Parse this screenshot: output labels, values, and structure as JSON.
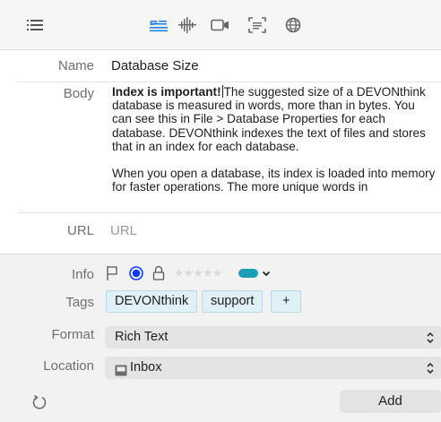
{
  "toolbar": {
    "icons": [
      "list-icon",
      "text-format-icon",
      "waveform-icon",
      "video-icon",
      "scan-icon",
      "globe-icon"
    ]
  },
  "fields": {
    "name_label": "Name",
    "name_value": "Database Size",
    "body_label": "Body",
    "body_bold": "Index is important!",
    "body_p1_rest": "The suggested size of a DEVONthink database is measured in words, more than in bytes. You can see this in File > Database Properties for each database. DEVONthink indexes the text of files and stores that in an index for each database.",
    "body_p2": "When you open a database, its index is loaded into memory for faster operations. The more unique words in",
    "url_label": "URL",
    "url_placeholder": "URL"
  },
  "info": {
    "label": "Info",
    "tags_label": "Tags",
    "tags": [
      "DEVONthink",
      "support"
    ],
    "add_tag": "+",
    "rating": 0,
    "label_color": "#1a9fb5",
    "flag_color": "#0a3cff"
  },
  "format": {
    "label": "Format",
    "value": "Rich Text"
  },
  "location": {
    "label": "Location",
    "value": "Inbox"
  },
  "actions": {
    "add": "Add"
  }
}
